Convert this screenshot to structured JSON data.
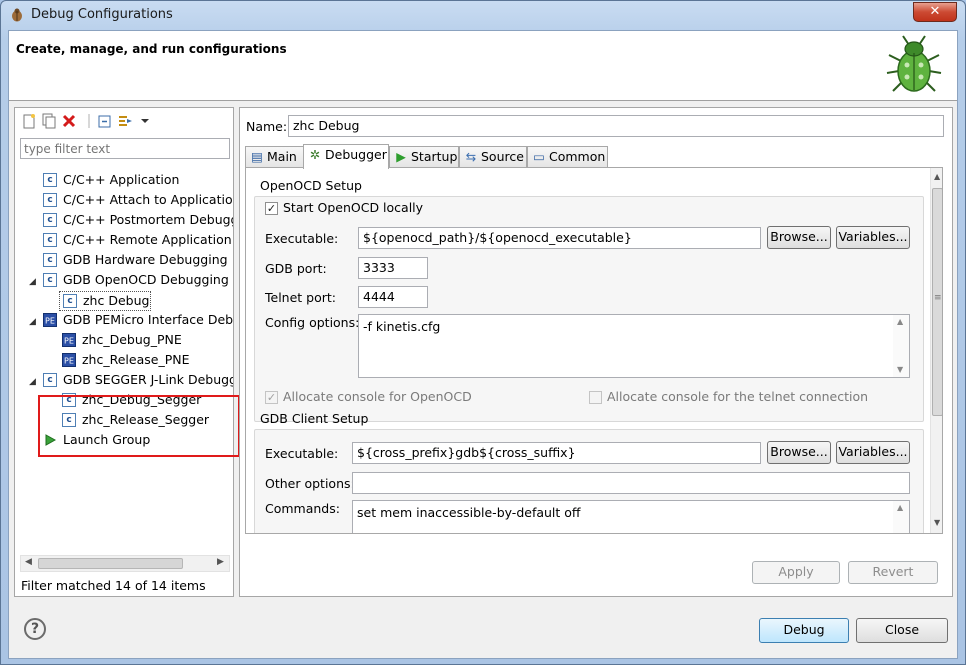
{
  "window": {
    "title": "Debug Configurations",
    "close_glyph": "✕"
  },
  "header": {
    "heading": "Create, manage, and run configurations"
  },
  "left": {
    "filter_placeholder": "type filter text",
    "tree": [
      {
        "label": "C/C++ Application",
        "icon": "c-config-icon"
      },
      {
        "label": "C/C++ Attach to Application",
        "icon": "c-config-icon"
      },
      {
        "label": "C/C++ Postmortem Debugg",
        "icon": "c-config-icon"
      },
      {
        "label": "C/C++ Remote Application",
        "icon": "c-config-icon"
      },
      {
        "label": "GDB Hardware Debugging",
        "icon": "c-config-icon"
      },
      {
        "label": "GDB OpenOCD Debugging",
        "icon": "c-config-icon"
      },
      {
        "label": "zhc Debug",
        "icon": "c-config-icon"
      },
      {
        "label": "GDB PEMicro Interface Debu",
        "icon": "pe-config-icon"
      },
      {
        "label": "zhc_Debug_PNE",
        "icon": "pe-config-icon"
      },
      {
        "label": "zhc_Release_PNE",
        "icon": "pe-config-icon"
      },
      {
        "label": "GDB SEGGER J-Link Debugg",
        "icon": "c-config-icon"
      },
      {
        "label": "zhc_Debug_Segger",
        "icon": "c-config-icon"
      },
      {
        "label": "zhc_Release_Segger",
        "icon": "c-config-icon"
      },
      {
        "label": "Launch Group",
        "icon": "launch-group-icon"
      }
    ],
    "icon_letter": "c",
    "expanded_glyph": "◢",
    "scroll_left_glyph": "◀",
    "scroll_right_glyph": "▶",
    "filter_status": "Filter matched 14 of 14 items"
  },
  "right": {
    "name_label": "Name:",
    "name_value": "zhc Debug",
    "tabs": [
      {
        "label": "Main",
        "glyph": "▤"
      },
      {
        "label": "Debugger",
        "glyph": "✲"
      },
      {
        "label": "Startup",
        "glyph": "▶"
      },
      {
        "label": "Source",
        "glyph": "⇆"
      },
      {
        "label": "Common",
        "glyph": "▭"
      }
    ],
    "openocd": {
      "title": "OpenOCD Setup",
      "start_locally": "Start OpenOCD locally",
      "executable_label": "Executable:",
      "executable_value": "${openocd_path}/${openocd_executable}",
      "gdb_port_label": "GDB port:",
      "gdb_port_value": "3333",
      "telnet_port_label": "Telnet port:",
      "telnet_port_value": "4444",
      "config_label": "Config options:",
      "config_value": "-f kinetis.cfg",
      "allocate_console": "Allocate console for OpenOCD",
      "allocate_telnet": "Allocate console for the telnet connection"
    },
    "gdb_client": {
      "title": "GDB Client Setup",
      "executable_label": "Executable:",
      "executable_value": "${cross_prefix}gdb${cross_suffix}",
      "other_label": "Other options:",
      "other_value": "",
      "commands_label": "Commands:",
      "commands_value": "set mem inaccessible-by-default off"
    },
    "browse_label": "Browse...",
    "variables_label": "Variables...",
    "check_glyph": "✓",
    "scroll_up_glyph": "▲",
    "scroll_down_glyph": "▼",
    "scroll_grip_glyph": "≡",
    "apply_label": "Apply",
    "revert_label": "Revert"
  },
  "footer": {
    "help_glyph": "?",
    "debug_label": "Debug",
    "close_label": "Close"
  }
}
